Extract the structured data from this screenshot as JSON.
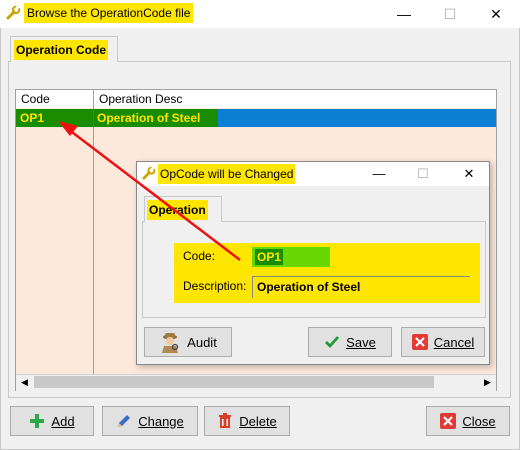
{
  "window": {
    "title": "Browse the OperationCode file",
    "minimize_glyph": "—",
    "maximize_glyph": "☐",
    "close_glyph": "✕"
  },
  "tabs": [
    {
      "label": "Operation Code"
    }
  ],
  "grid": {
    "columns": [
      "Code",
      "Operation Desc"
    ],
    "rows": [
      {
        "code": "OP1",
        "desc": "Operation of Steel",
        "selected": true
      }
    ]
  },
  "scroll": {
    "left_arrow": "◀",
    "right_arrow": "▶"
  },
  "buttons": {
    "add": "Add",
    "change": "Change",
    "delete": "Delete",
    "close": "Close"
  },
  "dialog": {
    "title": "OpCode will be Changed",
    "minimize_glyph": "—",
    "maximize_glyph": "☐",
    "close_glyph": "✕",
    "tab": "Operation",
    "fields": {
      "code_label": "Code:",
      "code_value": "OP1",
      "desc_label": "Description:",
      "desc_value": "Operation of Steel"
    },
    "buttons": {
      "audit": "Audit",
      "save": "Save",
      "cancel": "Cancel"
    }
  },
  "colors": {
    "highlight": "#ffe600",
    "selection": "#0a7fd4",
    "green": "#1a8c00",
    "arrow": "#ee1111"
  }
}
